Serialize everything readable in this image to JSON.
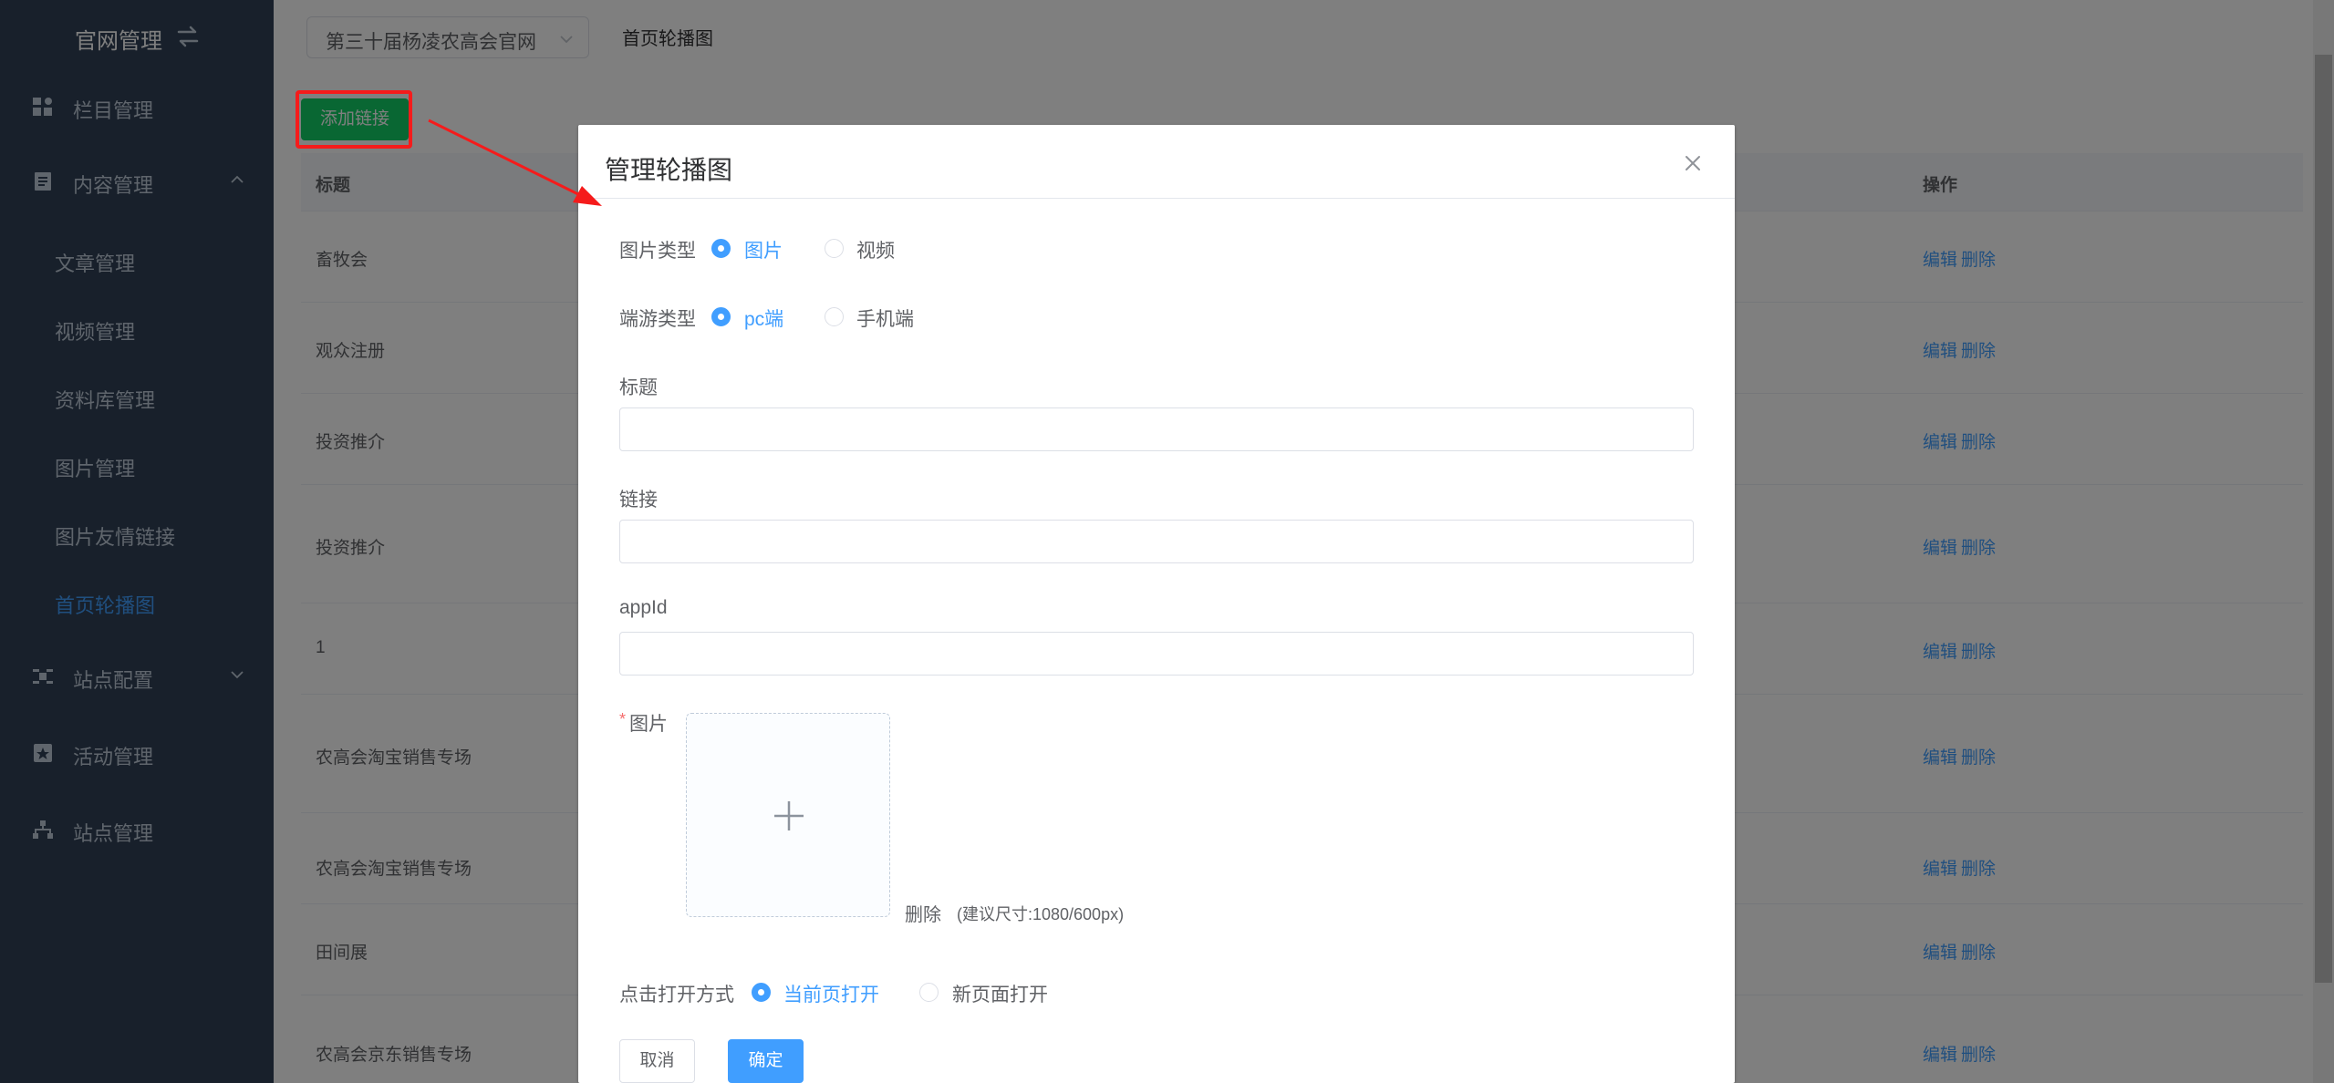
{
  "sidebar": {
    "logo_text": "官网管理",
    "menu": [
      {
        "label": "栏目管理",
        "icon": "grid-icon"
      },
      {
        "label": "内容管理",
        "icon": "document-icon",
        "expanded": true
      },
      {
        "label": "站点配置",
        "icon": "drone-icon",
        "expanded": false
      },
      {
        "label": "活动管理",
        "icon": "star-box-icon"
      },
      {
        "label": "站点管理",
        "icon": "sitemap-icon"
      }
    ],
    "submenu": [
      {
        "label": "文章管理",
        "active": false
      },
      {
        "label": "视频管理",
        "active": false
      },
      {
        "label": "资料库管理",
        "active": false
      },
      {
        "label": "图片管理",
        "active": false
      },
      {
        "label": "图片友情链接",
        "active": false
      },
      {
        "label": "首页轮播图",
        "active": true
      }
    ]
  },
  "header": {
    "site_select_value": "第三十届杨凌农高会官网",
    "breadcrumb": "首页轮播图"
  },
  "toolbar": {
    "add_label": "添加链接"
  },
  "table": {
    "columns": {
      "title": "标题",
      "actions": "操作"
    },
    "rows": [
      {
        "title": "畜牧会",
        "edit": "编辑",
        "delete": "删除"
      },
      {
        "title": "观众注册",
        "edit": "编辑",
        "delete": "删除"
      },
      {
        "title": "投资推介",
        "edit": "编辑",
        "delete": "删除"
      },
      {
        "title": "投资推介",
        "edit": "编辑",
        "delete": "删除"
      },
      {
        "title": "1",
        "edit": "编辑",
        "delete": "删除"
      },
      {
        "title": "农高会淘宝销售专场",
        "edit": "编辑",
        "delete": "删除"
      },
      {
        "title": "农高会淘宝销售专场",
        "edit": "编辑",
        "delete": "删除"
      },
      {
        "title": "田间展",
        "edit": "编辑",
        "delete": "删除"
      },
      {
        "title": "农高会京东销售专场",
        "edit": "编辑",
        "delete": "删除"
      }
    ]
  },
  "dialog": {
    "title": "管理轮播图",
    "image_type": {
      "label": "图片类型",
      "options": [
        "图片",
        "视频"
      ],
      "selected": "图片"
    },
    "platform_type": {
      "label": "端游类型",
      "options": [
        "pc端",
        "手机端"
      ],
      "selected": "pc端"
    },
    "title_field": {
      "label": "标题",
      "value": ""
    },
    "link_field": {
      "label": "链接",
      "value": ""
    },
    "appid_field": {
      "label": "appId",
      "value": ""
    },
    "image_field": {
      "required_mark": "*",
      "label": "图片",
      "delete_label": "删除",
      "hint": "(建议尺寸:1080/600px)"
    },
    "open_mode": {
      "label": "点击打开方式",
      "options": [
        "当前页打开",
        "新页面打开"
      ],
      "selected": "当前页打开"
    },
    "cancel_label": "取消",
    "ok_label": "确定"
  },
  "colors": {
    "sidebar_bg": "#304156",
    "primary": "#409eff",
    "add_button": "#13ce66",
    "highlight": "#f51b1b"
  }
}
